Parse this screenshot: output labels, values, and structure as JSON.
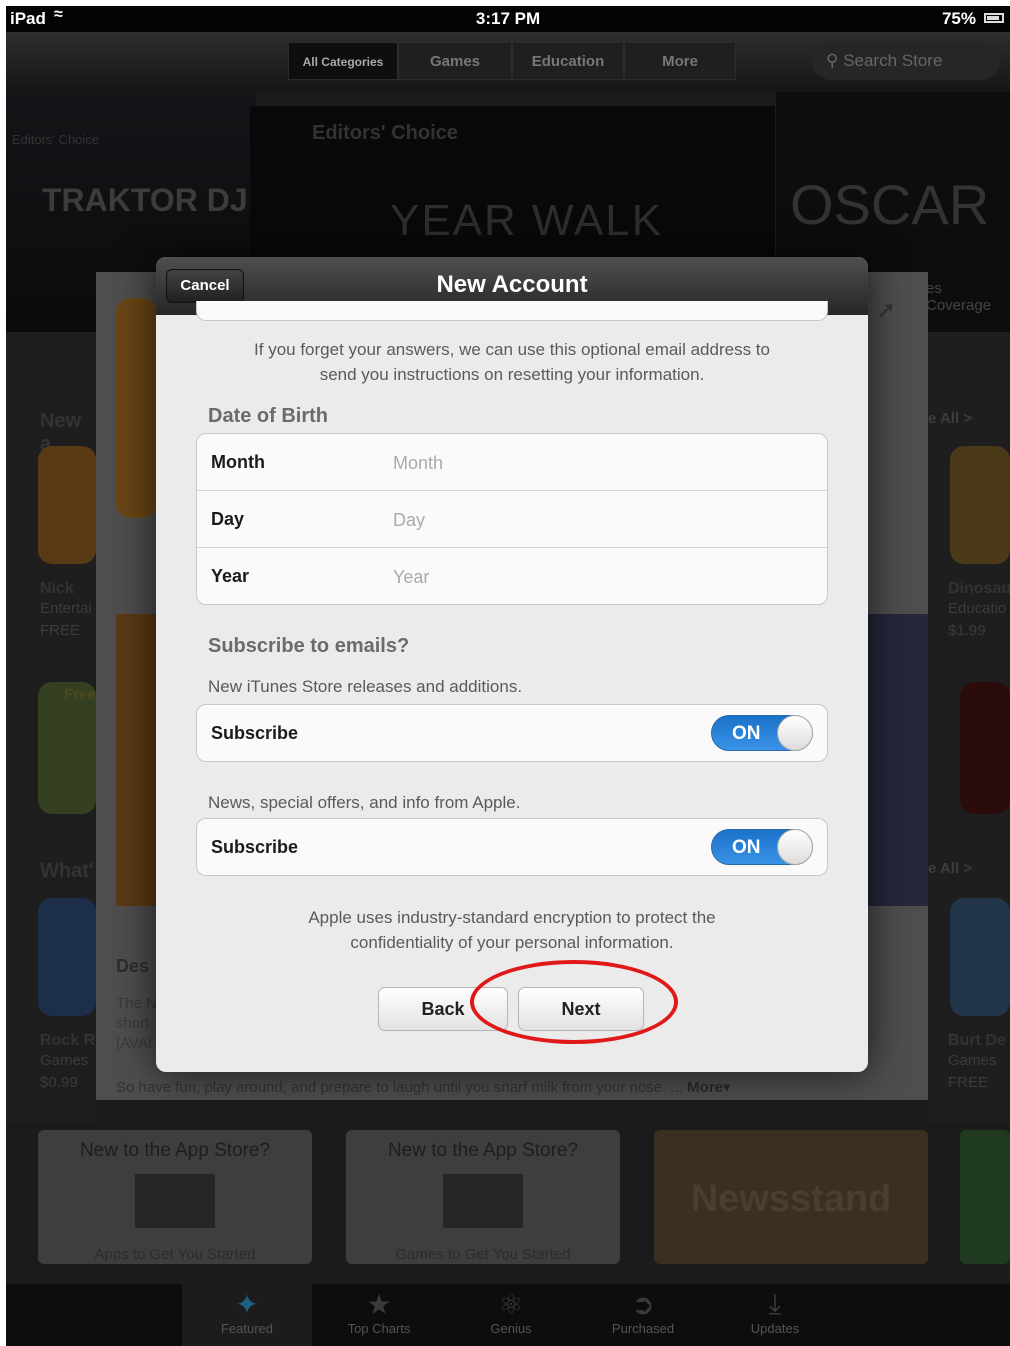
{
  "status_bar": {
    "carrier": "iPad",
    "time": "3:17 PM",
    "battery": "75%"
  },
  "toolbar": {
    "categories": [
      "All Categories",
      "Games",
      "Education",
      "More"
    ],
    "search_placeholder": "Search Store"
  },
  "background": {
    "banners": {
      "left": "Editors' Choice",
      "center": "Editors' Choice",
      "traktor": "TRAKTOR DJ",
      "year_walk": "YEAR WALK",
      "oscar": "OSCAR",
      "coverage": "es Coverage"
    },
    "left_app": {
      "name": "Nick",
      "genre": "Entertai",
      "price": "FREE"
    },
    "right_app": {
      "name": "Dinosau",
      "genre": "Educatio",
      "price": "$1.99"
    },
    "left_app2": {
      "name": "Rock R",
      "genre": "Games",
      "price": "$0.99"
    },
    "right_app2": {
      "name": "Burt De",
      "genre": "Games",
      "price": "FREE"
    },
    "new_label": "New a",
    "whats_label": "What'",
    "see_all": "e All >",
    "description_heading": "Des",
    "description_snippet": "The N\nshort\n[AVAI",
    "free_tag": "Free",
    "footer_line": "So have fun, play around, and prepare to laugh until you snarf milk from your nose. ...",
    "more_link": "More",
    "promos": [
      {
        "title": "New to the App Store?",
        "sub": "Apps to Get You Started"
      },
      {
        "title": "New to the App Store?",
        "sub": "Games to Get You Started"
      },
      {
        "title": "Newsstand",
        "sub": ""
      }
    ]
  },
  "tabbar": {
    "tabs": [
      {
        "label": "Featured",
        "icon": "featured-icon"
      },
      {
        "label": "Top Charts",
        "icon": "star-icon"
      },
      {
        "label": "Genius",
        "icon": "atom-icon"
      },
      {
        "label": "Purchased",
        "icon": "purchased-icon"
      },
      {
        "label": "Updates",
        "icon": "download-icon"
      }
    ]
  },
  "modal": {
    "title": "New Account",
    "cancel": "Cancel",
    "email_note_line1": "If you forget your answers, we can use this optional email address to",
    "email_note_line2": "send you instructions on resetting your information.",
    "dob_label": "Date of Birth",
    "dob_fields": [
      {
        "key": "Month",
        "placeholder": "Month"
      },
      {
        "key": "Day",
        "placeholder": "Day"
      },
      {
        "key": "Year",
        "placeholder": "Year"
      }
    ],
    "subscribe_heading": "Subscribe to emails?",
    "itunes_note": "New iTunes Store releases and additions.",
    "apple_note": "News, special offers, and info from Apple.",
    "subscribe_label": "Subscribe",
    "toggle_on": "ON",
    "privacy_line1": "Apple uses industry-standard encryption to protect the",
    "privacy_line2": "confidentiality of your personal information.",
    "back": "Back",
    "next": "Next"
  },
  "colors": {
    "toggle_on": "#2a84d6",
    "highlight": "#e01818"
  }
}
